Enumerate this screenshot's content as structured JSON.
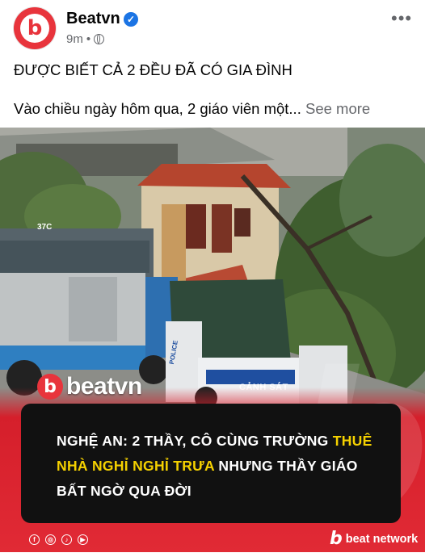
{
  "post": {
    "page_name": "Beatvn",
    "time": "9m",
    "meta_dot": "•",
    "avatar_letter": "b",
    "verified_mark": "✓",
    "more_icon": "•••",
    "caption_line1": "ĐƯỢC BIẾT CẢ 2 ĐỀU ĐÃ CÓ GIA ĐÌNH",
    "caption_line2": "Vào chiều ngày hôm qua, 2 giáo viên một...",
    "see_more": "See more"
  },
  "image": {
    "truck_plate": "37C",
    "police_label": "CẢNH SÁT",
    "police_side": "POLICE",
    "watermark_letter": "b",
    "watermark_word": "beatvn",
    "headline_part1": "NGHỆ AN: 2 THẦY, CÔ CÙNG TRƯỜNG ",
    "headline_highlight": "THUÊ NHÀ NGHỈ NGHỈ TRƯA",
    "headline_part2": " NHƯNG THẦY GIÁO BẤT NGỜ QUA ĐỜI",
    "footer_brand_letter": "b",
    "footer_brand": "beat network",
    "social_icons": [
      "facebook-icon",
      "instagram-icon",
      "tiktok-icon",
      "youtube-icon"
    ],
    "social_glyphs": [
      "f",
      "◎",
      "♪",
      "▶"
    ],
    "highlight_color": "#f5d100",
    "brand_color": "#e8343c"
  }
}
